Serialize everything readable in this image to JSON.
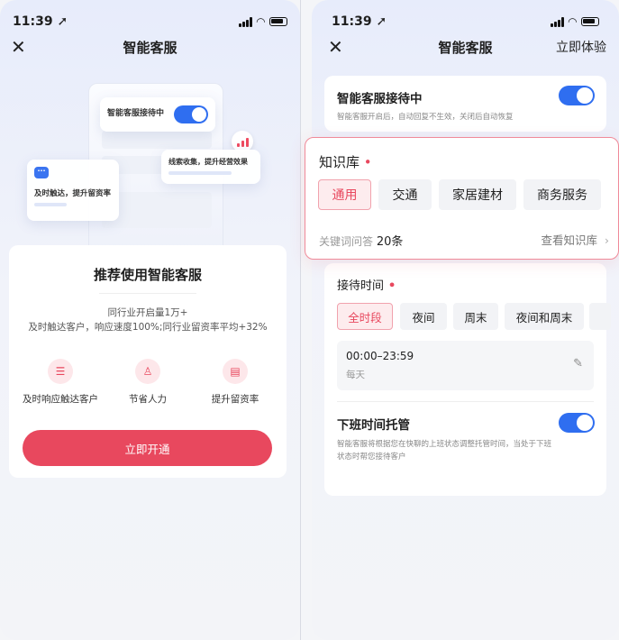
{
  "status": {
    "time": "11:39 ➚"
  },
  "left": {
    "title": "智能客服",
    "illustration": {
      "toggle_card_label": "智能客服接待中",
      "leads_card_label": "线索收集，提升经营效果",
      "reach_card_label": "及时触达，提升留资率"
    },
    "recommend": {
      "title": "推荐使用智能客服",
      "sub1": "同行业开启量1万+",
      "sub2": "及时触达客户，响应速度100%;同行业留资率平均+32%",
      "features": [
        {
          "label": "及时响应触达客户",
          "icon": "chat-icon"
        },
        {
          "label": "节省人力",
          "icon": "person-icon"
        },
        {
          "label": "提升留资率",
          "icon": "document-icon"
        }
      ],
      "button": "立即开通"
    }
  },
  "right": {
    "title": "智能客服",
    "action": "立即体验",
    "reception": {
      "title": "智能客服接待中",
      "desc": "智能客服开启后，自动回复不生效，关闭后自动恢复",
      "enabled": true
    },
    "knowledge": {
      "title": "知识库",
      "required": "•",
      "chips": [
        "通用",
        "交通",
        "家居建材",
        "商务服务"
      ],
      "selected": "通用",
      "qa_label": "关键词问答",
      "qa_count": "20条",
      "view_link": "查看知识库",
      "view_arrow": "›"
    },
    "schedule": {
      "title": "接待时间",
      "required": "•",
      "chips": [
        "全时段",
        "夜间",
        "周末",
        "夜间和周末"
      ],
      "selected": "全时段",
      "time_range": "00:00–23:59",
      "repeat": "每天",
      "edit_icon": "✎"
    },
    "offhours": {
      "title": "下班时间托管",
      "desc1": "智能客服将根据您在快聊的上班状态调整托管时间，当处于下班",
      "desc2": "状态时帮您接待客户",
      "enabled": true
    }
  },
  "colors": {
    "accent": "#e8485e",
    "toggle": "#2f6ef0"
  }
}
